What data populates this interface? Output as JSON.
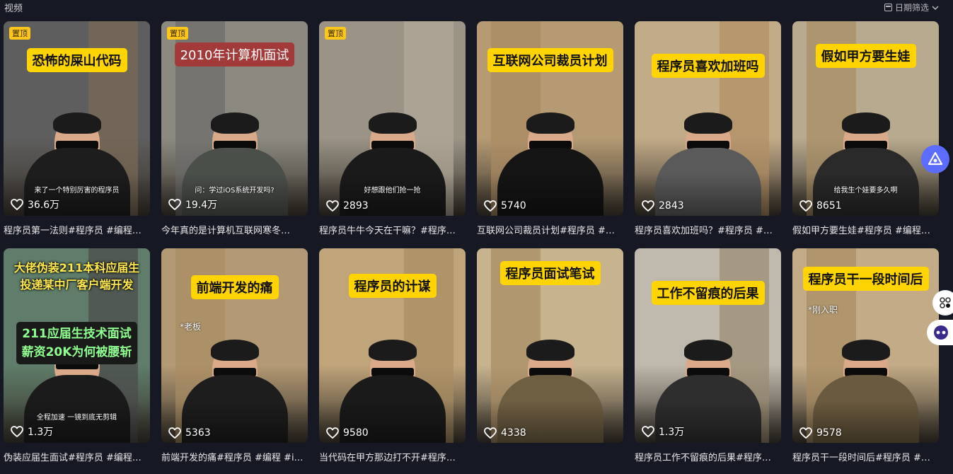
{
  "header": {
    "section_title": "视频",
    "date_filter_label": "日期筛选"
  },
  "icons": {
    "calendar": "calendar-icon",
    "chevron": "chevron-down-icon",
    "heart": "heart-icon",
    "ai": "ai-assistant-icon",
    "share": "share-icon",
    "bot": "bot-icon"
  },
  "colors": {
    "background": "#161823",
    "caption": "#ffd400",
    "pin": "#ffc61a",
    "accent": "#5b6cff"
  },
  "videos": [
    {
      "pin": "置顶",
      "caption": "恐怖的屎山代码",
      "subtitle": "来了一个特别厉害的程序员",
      "likes": "36.6万",
      "title": "程序员第一法则#程序员 #编程…"
    },
    {
      "pin": "置顶",
      "caption": "2010年计算机面试",
      "subtitle": "问：学过iOS系统开发吗?",
      "likes": "19.4万",
      "title": "今年真的是计算机互联网寒冬…"
    },
    {
      "pin": "置顶",
      "caption": "",
      "subtitle": "好想跟他们抢一抢",
      "likes": "2893",
      "title": "程序员牛牛今天在干嘛？#程序…"
    },
    {
      "pin": "",
      "caption": "互联网公司裁员计划",
      "subtitle": "",
      "likes": "5740",
      "title": "互联网公司裁员计划#程序员 #…"
    },
    {
      "pin": "",
      "caption": "程序员喜欢加班吗",
      "subtitle": "",
      "likes": "2843",
      "title": "程序员喜欢加班吗？#程序员 #…"
    },
    {
      "pin": "",
      "caption": "假如甲方要生娃",
      "subtitle": "给我生个娃要多久啊",
      "likes": "8651",
      "title": "假如甲方要生娃#程序员 #编程…"
    },
    {
      "pin": "",
      "caption": "大佬伪装211本科应届生\n投递某中厂客户端开发",
      "caption2": "211应届生技术面试\n薪资20K为何被腰斩",
      "subtitle": "全程加速 一镜到底无剪辑",
      "likes": "1.3万",
      "title": "伪装应届生面试#程序员 #编程…"
    },
    {
      "pin": "",
      "caption": "前端开发的痛",
      "note": "*老板",
      "subtitle": "",
      "likes": "5363",
      "title": "前端开发的痛#程序员 #编程 #i…"
    },
    {
      "pin": "",
      "caption": "程序员的计谋",
      "subtitle": "",
      "likes": "9580",
      "title": "当代码在甲方那边打不开#程序…"
    },
    {
      "pin": "",
      "caption": "程序员面试笔试",
      "subtitle": "",
      "likes": "4338",
      "title": ""
    },
    {
      "pin": "",
      "caption": "工作不留痕的后果",
      "subtitle": "",
      "likes": "1.3万",
      "title": "程序员工作不留痕的后果#程序…"
    },
    {
      "pin": "",
      "caption": "程序员干一段时间后",
      "note": "*刚入职",
      "subtitle": "",
      "likes": "9578",
      "title": "程序员干一段时间后#程序员 #…"
    }
  ]
}
